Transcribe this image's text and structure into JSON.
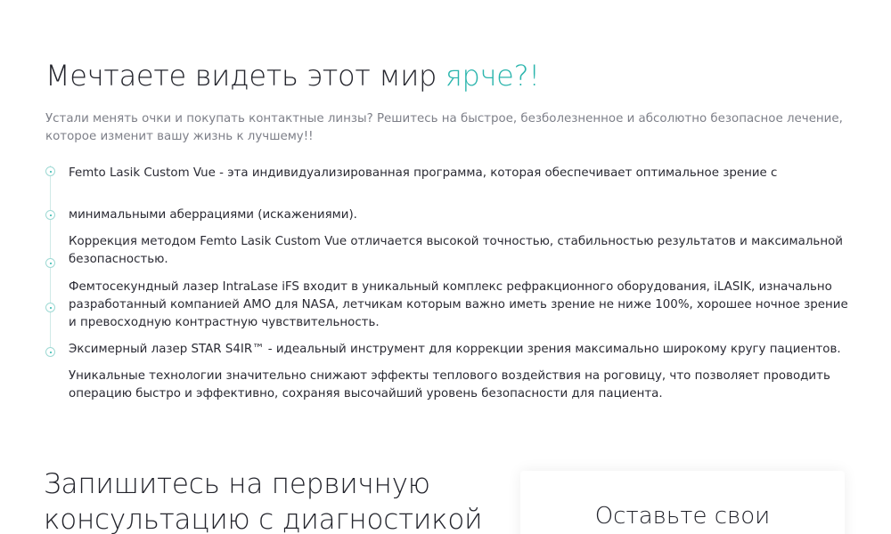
{
  "colors": {
    "accent": "#2bb5ad",
    "text_dark": "#22232b",
    "text_muted": "#7d7f88"
  },
  "hero": {
    "title_main": "Мечтаете видеть этот мир ",
    "title_accent": "ярче?!",
    "intro_line1": "Устали менять очки и покупать контактные линзы? Решитесь на быстрое, безболезненное и абсолютно безопасное лечение,",
    "intro_line2": "которое изменит вашу жизнь к лучшему!!"
  },
  "features": [
    {
      "line1": "Femto Lasik Custom Vue - эта индивидуализированная программа, которая обеспечивает оптимальное зрение с"
    },
    {
      "line1": "минимальными аберрациями (искажениями)."
    },
    {
      "line1": "Коррекция методом Femto Lasik Custom Vue отличается высокой точностью, стабильностью результатов и максимальной",
      "line2": "безопасностью."
    },
    {
      "line1": "Фемтосекундный лазер IntraLase iFS входит в уникальный комплекс рефракционного оборудования, iLASIK, изначально",
      "line2": "разработанный компанией АМО для NASA, летчикам которым важно иметь зрение не ниже 100%, хорошее ночное зрение",
      "line3": "и превосходную контрастную чувствительность."
    },
    {
      "line1": "Эксимерный лазер STAR S4IR™ - идеальный инструмент для коррекции зрения максимально широкому кругу пациентов."
    },
    {
      "line1": "Уникальные технологии значительно снижают эффекты теплового воздействия на роговицу, что позволяет проводить",
      "line2": "операцию быстро и эффективно, сохраняя высочайший уровень безопасности для пациента."
    }
  ],
  "cta": {
    "title_line1": "Запишитесь на первичную",
    "title_line2": "консультацию с диагностикой",
    "card_title": "Оставьте свои"
  }
}
